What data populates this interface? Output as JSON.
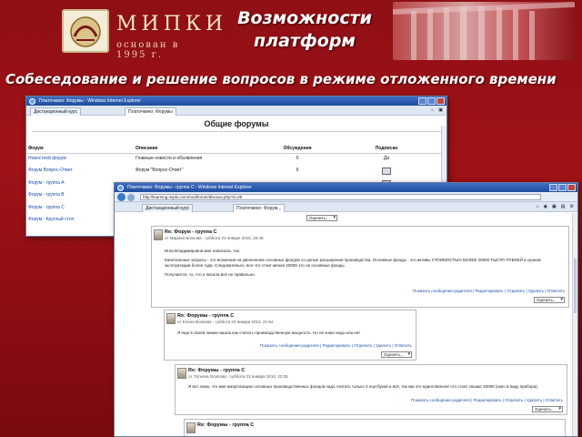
{
  "header": {
    "logo_name": "МИПКИ",
    "logo_sub": "основан в 1995 г.",
    "title": "Возможности платформ",
    "subtitle": "Собеседование и решение вопросов в режиме отложенного времени"
  },
  "win1": {
    "titlebar": "Платочкино: Форумы - Windows Internet Explorer",
    "tabs": [
      "Дистанционный курс",
      "Платочкино: Форумы"
    ],
    "page_title": "Общие форумы",
    "columns": [
      "Форум",
      "Описание",
      "Обсуждения",
      "Подписан"
    ],
    "rows": [
      {
        "forum": "Новостной форум",
        "desc": "Главные новости и объявления",
        "disc": "0",
        "sub": "Да"
      },
      {
        "forum": "Форум Вопрос-Ответ",
        "desc": "Форум \"Вопрос-Ответ\"",
        "disc": "6",
        "sub": ""
      },
      {
        "forum": "Форум - группа А",
        "desc": "",
        "disc": "",
        "sub": ""
      },
      {
        "forum": "Форум - группа В",
        "desc": "",
        "disc": "",
        "sub": ""
      },
      {
        "forum": "Форум - группа С",
        "desc": "",
        "disc": "",
        "sub": ""
      },
      {
        "forum": "Форум - Круглый стол",
        "desc": "",
        "disc": "",
        "sub": ""
      }
    ]
  },
  "win2": {
    "titlebar": "Платочкино: Форумы - группа С - Windows Internet Explorer",
    "address": "http://learning.mipki.com/mod/forum/discuss.php?d=28",
    "tabs": [
      "Дистанционный курс",
      "Платочкино: Форум..."
    ],
    "rate_label": "Оценить...",
    "post1": {
      "subject": "Re: Форум - группа С",
      "by": "от Марина Волкова - суббота 23 января 2010, 20:46",
      "quote": "Инга Владимировна мне написала, так:",
      "body": "Капитальные затраты - это вложения на увеличение основных фондов со целью расширения производства. Основные фонды - это активы СТОИМОСТЬЮ БОЛЕЕ 20000 ТЫСЯЧ РУБЛЕЙ и сроком эксплуатации более года. Следовательно, все что стоит менее 20000 это не основные фонды.",
      "body2": "Получается, то, что я писала всё не правильно.",
      "links": "Показать сообщение-родителя | Редактировать | Отделить | Удалить | Ответить"
    },
    "post2": {
      "subject": "Re: Форумы - группа С",
      "by": "от Елена Волкова - суббота 23 января 2010, 21:54",
      "body": "Я еще в своей линии нашла как считать производственную мощность. Но не знаю надо или нет",
      "links": "Показать сообщение-родителя | Редактировать | Отделить | Удалить | Ответить"
    },
    "post3": {
      "subject": "Re: Форумы - группа С",
      "by": "от Татьяна Осипова - суббота 23 января 2010, 22:28",
      "body": "Я вот знаю, что мне амортизацию основных производственных фондов надо считать только 2 ноутбуков и всё, так как это единственное что стоит свыше 20000 (окно в виду прибора).",
      "links": "Показать сообщение-родителя | Редактировать | Отделить | Удалить | Ответить"
    },
    "post4": {
      "subject": "Re: Форумы - группа С"
    }
  }
}
